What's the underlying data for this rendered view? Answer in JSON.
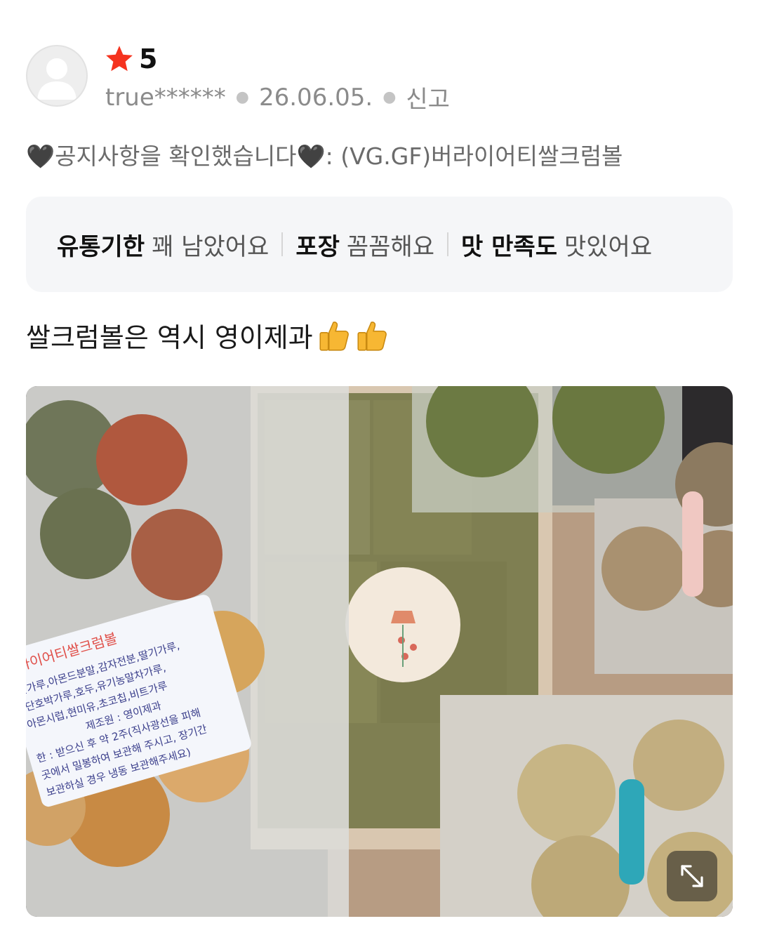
{
  "review": {
    "rating": "5",
    "user": "true******",
    "date": "26.06.05.",
    "report_label": "신고",
    "notice": "🖤공지사항을 확인했습니다🖤: (VG.GF)버라이어티쌀크럼볼",
    "tags": [
      {
        "key": "유통기한",
        "value": "꽤 남았어요"
      },
      {
        "key": "포장",
        "value": "꼼꼼해요"
      },
      {
        "key": "맛 만족도",
        "value": "맛있어요"
      }
    ],
    "text": "쌀크럼볼은 역시 영이제과"
  },
  "photo": {
    "label_title": "라이어티쌀크럼볼",
    "label_lines": [
      "쌀가루,아몬드분말,감자전분,딸기가루,",
      ",단호박가루,호두,유기농말차가루,",
      "아몬시럽,현미유,초코칩,비트가루",
      "제조원 : 영이제과",
      "한 : 받으신 후 약 2주(직사광선을 피해",
      "곳에서 밀봉하여 보관해 주시고, 장기간",
      "보관하실 경우 냉동 보관해주세요)"
    ]
  },
  "colors": {
    "star": "#f5331f",
    "meta": "#8b8b8b",
    "tag_bg": "#f5f6f8"
  },
  "icons": [
    "avatar-placeholder-icon",
    "star-icon",
    "thumbs-up-icon",
    "expand-icon"
  ]
}
